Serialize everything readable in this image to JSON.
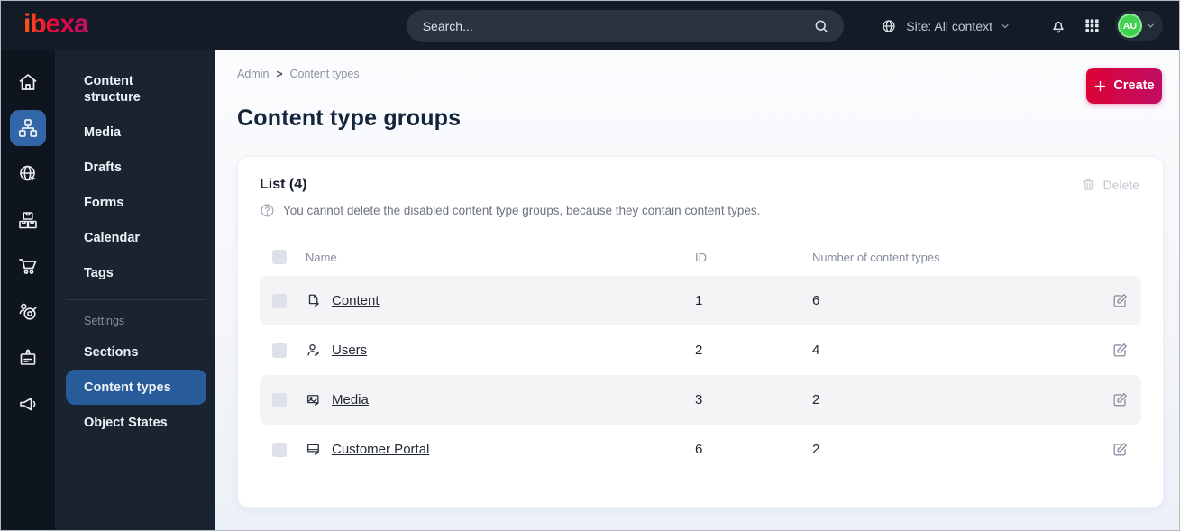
{
  "topbar": {
    "logo": "ibexa",
    "search_placeholder": "Search...",
    "site_context": "Site: All context",
    "avatar_initials": "AU"
  },
  "sidebar": {
    "rail_icons": [
      "home-icon",
      "content-structure-icon",
      "site-globe-icon",
      "products-boxes-icon",
      "commerce-cart-icon",
      "personalization-target-icon",
      "badge-icon",
      "campaign-megaphone-icon"
    ],
    "rail_active_index": 1,
    "items": [
      {
        "label": "Content structure"
      },
      {
        "label": "Media"
      },
      {
        "label": "Drafts"
      },
      {
        "label": "Forms"
      },
      {
        "label": "Calendar"
      },
      {
        "label": "Tags"
      }
    ],
    "settings_label": "Settings",
    "settings_items": [
      {
        "label": "Sections"
      },
      {
        "label": "Content types",
        "active": true
      },
      {
        "label": "Object States"
      }
    ]
  },
  "main": {
    "breadcrumb": {
      "items": [
        "Admin",
        "Content types"
      ],
      "separator": ">"
    },
    "create_label": "Create",
    "page_title": "Content type groups",
    "card": {
      "list_title": "List (4)",
      "info_text": "You cannot delete the disabled content type groups, because they contain content types.",
      "delete_label": "Delete",
      "table": {
        "headers": {
          "name": "Name",
          "id": "ID",
          "count": "Number of content types"
        },
        "rows": [
          {
            "icon": "content-file-icon",
            "name": "Content",
            "id": "1",
            "count": "6"
          },
          {
            "icon": "users-person-icon",
            "name": "Users",
            "id": "2",
            "count": "4"
          },
          {
            "icon": "media-image-icon",
            "name": "Media",
            "id": "3",
            "count": "2"
          },
          {
            "icon": "customer-portal-monitor-icon",
            "name": "Customer Portal",
            "id": "6",
            "count": "2"
          }
        ]
      }
    }
  },
  "colors": {
    "topbar_bg": "#131b26",
    "rail_bg": "#0f151e",
    "menu_bg": "#1a2430",
    "active_blue": "#275b9a",
    "accent_gradient_start": "#dc0335",
    "accent_gradient_end": "#c00d63",
    "avatar_green": "#3fd14f",
    "zebra_row": "#f4f4f6"
  }
}
